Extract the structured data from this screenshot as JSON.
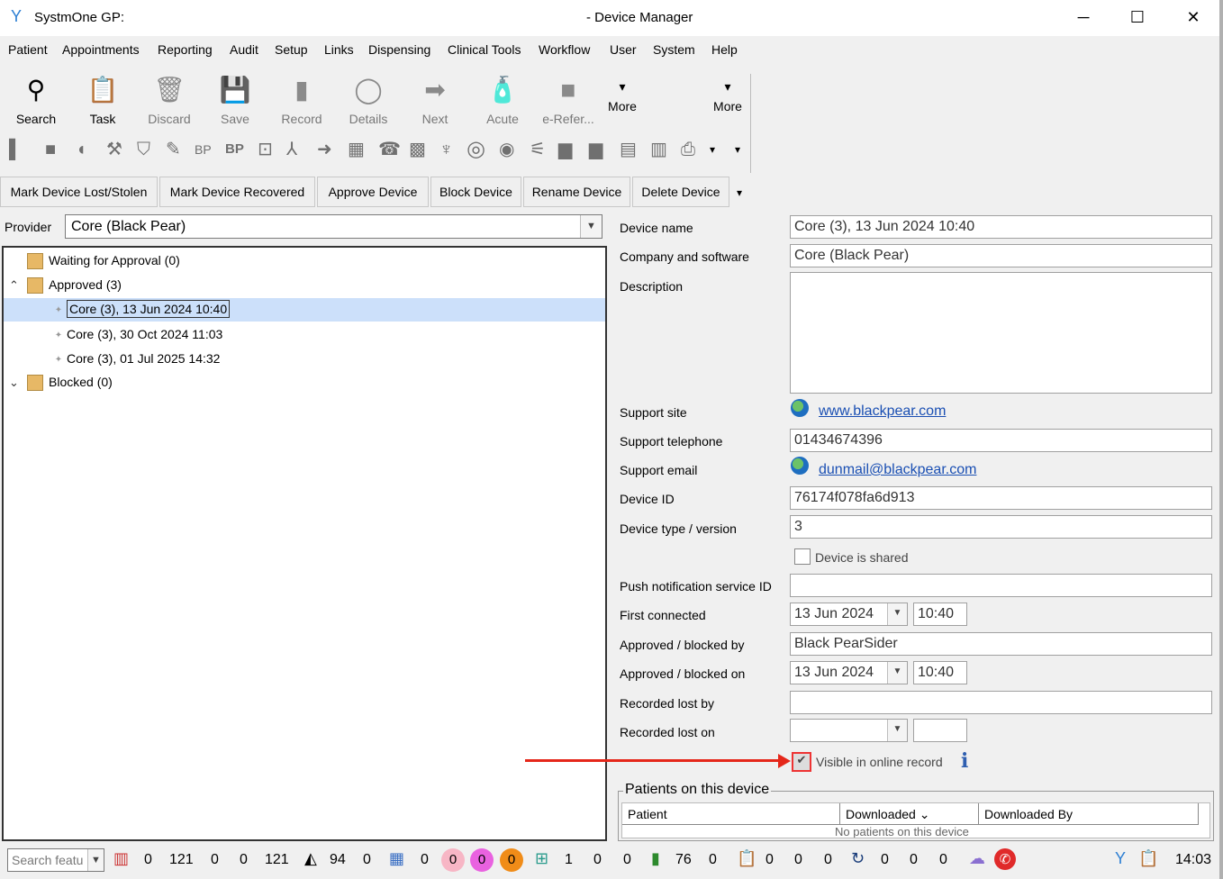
{
  "window": {
    "app_title": "SystmOne GP:",
    "title": "- Device Manager",
    "minimize": "─",
    "maximize": "☐",
    "close": "✕"
  },
  "menu": [
    "Patient",
    "Appointments",
    "Reporting",
    "Audit",
    "Setup",
    "Links",
    "Dispensing",
    "Clinical Tools",
    "Workflow",
    "User",
    "System",
    "Help"
  ],
  "toolbar": [
    {
      "label": "Search",
      "icon": "search-icon",
      "glyph": "⚲"
    },
    {
      "label": "Task",
      "icon": "task-icon",
      "glyph": "📋"
    },
    {
      "label": "Discard",
      "icon": "trash-icon",
      "glyph": "🗑"
    },
    {
      "label": "Save",
      "icon": "save-icon",
      "glyph": "💾"
    },
    {
      "label": "Record",
      "icon": "record-icon",
      "glyph": "▮"
    },
    {
      "label": "Details",
      "icon": "details-icon",
      "glyph": "◯"
    },
    {
      "label": "Next",
      "icon": "next-icon",
      "glyph": "➡"
    },
    {
      "label": "Acute",
      "icon": "acute-icon",
      "glyph": "🧴"
    },
    {
      "label": "e-Refer...",
      "icon": "erefer-icon",
      "glyph": "■"
    },
    {
      "label": "More",
      "icon": "more-icon",
      "glyph": "▾"
    },
    {
      "label": "More",
      "icon": "more-icon",
      "glyph": "▾"
    }
  ],
  "actions": [
    "Mark Device Lost/Stolen",
    "Mark Device Recovered",
    "Approve Device",
    "Block Device",
    "Rename Device",
    "Delete Device"
  ],
  "provider": {
    "label": "Provider",
    "value": "Core (Black Pear)"
  },
  "tree": {
    "waiting": "Waiting for Approval (0)",
    "approved": "Approved (3)",
    "devices": [
      "Core (3), 13 Jun 2024 10:40",
      "Core (3), 30 Oct 2024 11:03",
      "Core (3), 01 Jul 2025 14:32"
    ],
    "blocked": "Blocked (0)"
  },
  "form": {
    "device_name": {
      "label": "Device name",
      "value": "Core (3), 13 Jun 2024 10:40"
    },
    "company": {
      "label": "Company and software",
      "value": "Core (Black Pear)"
    },
    "description": {
      "label": "Description",
      "value": ""
    },
    "support_site": {
      "label": "Support site",
      "value": "www.blackpear.com"
    },
    "support_telephone": {
      "label": "Support telephone",
      "value": "01434674396"
    },
    "support_email": {
      "label": "Support email",
      "value": "dunmail@blackpear.com"
    },
    "device_id": {
      "label": "Device ID",
      "value": "76174f078fa6d913"
    },
    "device_type": {
      "label": "Device type / version",
      "value": "3"
    },
    "shared": {
      "label": "Device is shared",
      "checked": false
    },
    "push_id": {
      "label": "Push notification service ID",
      "value": ""
    },
    "first_connected": {
      "label": "First connected",
      "date": "13 Jun 2024",
      "time": "10:40"
    },
    "approved_by": {
      "label": "Approved / blocked by",
      "value": "Black PearSider"
    },
    "approved_on": {
      "label": "Approved / blocked on",
      "date": "13 Jun 2024",
      "time": "10:40"
    },
    "lost_by": {
      "label": "Recorded lost by",
      "value": ""
    },
    "lost_on": {
      "label": "Recorded lost on",
      "date": "",
      "time": ""
    },
    "visible": {
      "label": "Visible in online record",
      "checked": true
    }
  },
  "patients": {
    "legend": "Patients on this device",
    "columns": [
      "Patient",
      "Downloaded ⌄",
      "Downloaded By"
    ],
    "empty": "No patients on this device"
  },
  "status": {
    "search_placeholder": "Search featu",
    "counts": [
      "0",
      "121",
      "0",
      "0",
      "121",
      "94",
      "0",
      "0",
      "0",
      "0",
      "0",
      "1",
      "0",
      "0",
      "76",
      "0",
      "0",
      "0",
      "0",
      "0",
      "0",
      "0"
    ],
    "clock": "14:03"
  },
  "colors": {
    "accent": "#2d7fd3",
    "selection": "#cce0fa",
    "annotation": "#e5271a",
    "link": "#1a4fb3"
  }
}
